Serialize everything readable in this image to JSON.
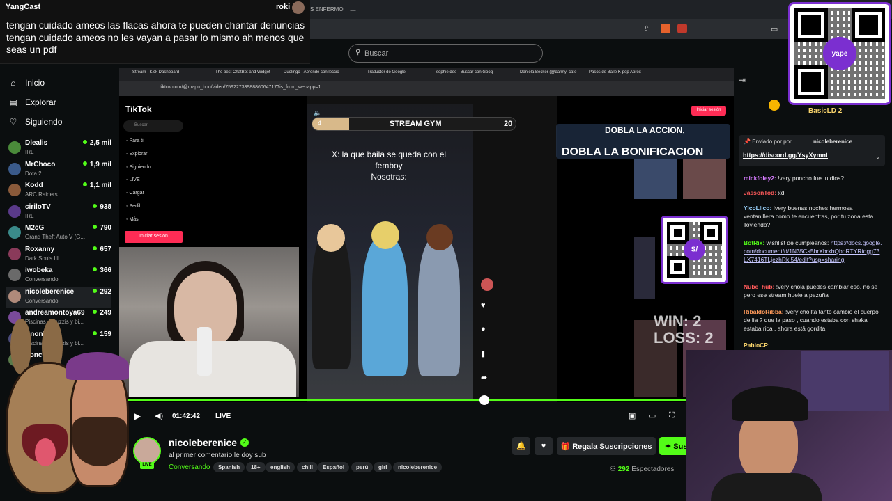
{
  "overlay": {
    "title": "YangCast",
    "user": "roki",
    "text": "tengan cuidado ameos las flacas ahora te pueden chantar denuncias tengan cuidado ameos no les vayan a pasar lo mismo ah menos que seas un pdf"
  },
  "top": {
    "tab_fragment": "S ENFERMO",
    "search_placeholder": "Buscar"
  },
  "nav": [
    {
      "label": "Inicio",
      "icon": "home-icon"
    },
    {
      "label": "Explorar",
      "icon": "compass-icon"
    },
    {
      "label": "Siguiendo",
      "icon": "heart-icon"
    }
  ],
  "channels": [
    {
      "name": "Dlealis",
      "game": "IRL",
      "viewers": "2,5 mil",
      "color": "#4a8a3a"
    },
    {
      "name": "MrChoco",
      "game": "Dota 2",
      "viewers": "1,9 mil",
      "color": "#3a5a8a"
    },
    {
      "name": "Kodd",
      "game": "ARC Raiders",
      "viewers": "1,1 mil",
      "color": "#8a5a3a"
    },
    {
      "name": "cirilоTV",
      "game": "IRL",
      "viewers": "938",
      "color": "#5a3a8a"
    },
    {
      "name": "M2cG",
      "game": "Grand Theft Auto V (G...",
      "viewers": "790",
      "color": "#3a8a8a"
    },
    {
      "name": "Roxanny",
      "game": "Dark Souls III",
      "viewers": "657",
      "color": "#8a3a5a"
    },
    {
      "name": "iwobeka",
      "game": "Conversando",
      "viewers": "366",
      "color": "#6a6a6a"
    },
    {
      "name": "nicoleberenice",
      "game": "Conversando",
      "viewers": "292",
      "color": "#b08a7a"
    },
    {
      "name": "andreamontoya69",
      "game": "Piscinas, jacuzzis y bi...",
      "viewers": "249",
      "color": "#7a4a9a"
    },
    {
      "name": "AnonEb",
      "game": "Piscinas, jacuzzis y bi...",
      "viewers": "159",
      "color": "#4a4a7a"
    },
    {
      "name": "Ponch",
      "game": "",
      "viewers": "",
      "color": "#5a7a4a"
    }
  ],
  "inner_browser": {
    "tabs": [
      "Stream - Kick Dashboard",
      "The best ChatBot and Widget",
      "Duolingo - Aprende con leccio",
      "Traductor de Google",
      "sophie dee - Buscar con Goog",
      "Daniela Becker (@danny_cate",
      "Pasos de Baile K-pop Aprox"
    ],
    "url": "tiktok.com/@mapu_boo/video/7592273398886064717?is_from_webapp=1"
  },
  "tiktok": {
    "logo": "TikTok",
    "search_placeholder": "Buscar",
    "nav": [
      "Para ti",
      "Explorar",
      "Siguiendo",
      "LIVE",
      "Cargar",
      "Perfil",
      "Más"
    ],
    "login": "Iniciar sesión",
    "login_top": "Iniciar sesión",
    "caption": "X: la que baila se queda con el femboy\nNosotras:",
    "gym_left": "4",
    "gym_title": "STREAM GYM",
    "gym_right": "20",
    "gym_progress": 0.18,
    "dobla1": "DOBLA LA ACCION,",
    "dobla2": "DOBLA LA BONIFICACION",
    "win": "WIN: 2",
    "loss": "LOSS: 2"
  },
  "player": {
    "time": "01:42:42",
    "live": "LIVE"
  },
  "channel": {
    "name": "nicoleberenice",
    "title": "al primer comentario le doy sub",
    "category": "Conversando",
    "live": "LIVE",
    "tags": [
      "Spanish",
      "18+",
      "english",
      "chill",
      "Español",
      "perú",
      "girl",
      "nicoleberenice"
    ],
    "gift": "Regala Suscripciones",
    "sub": "Suscribirse",
    "viewers_count": "292",
    "viewers_label": "Espectadores"
  },
  "chat": {
    "pinned_label": "Enviado por",
    "pinned_user": "nicoleberenice",
    "pinned_link": "https://discord.gg/YsyXymnt",
    "top_user": "BasicLD",
    "top_count": "2",
    "messages": [
      {
        "user": "mickfoley2:",
        "text": " !very poncho fue tu dios?",
        "color": "#d77bff"
      },
      {
        "user": "JassonTod:",
        "text": " xd",
        "color": "#ff5a5a"
      },
      {
        "user": "YicoLlico:",
        "text": " !very buenas noches hermosa ventanillera como te encuentras, por tu zona esta lloviendo?",
        "color": "#9ad4ff"
      },
      {
        "user": "BotRix:",
        "text": " wishlist de cumpleaños:",
        "link": "https://docs.google.com/document/d/1N35Cs5brXbrkbQboRTYRfdgg73LX7416TLjezhRkI54/edit?usp=sharing",
        "color": "#53fc18"
      },
      {
        "user": "Nube_hub:",
        "text": " !very chola puedes cambiar eso, no se pero ese stream huele a pezuña",
        "color": "#ff5a5a"
      },
      {
        "user": "RibaldoRibba:",
        "text": " !very chollta tanto cambio el cuerpo de lia ? que la paso , cuando estaba con shaka estaba rica , ahora está gordita",
        "color": "#ff9a5a"
      },
      {
        "user": "PabloCP:",
        "text": "",
        "color": "#f7d26b"
      }
    ]
  },
  "colors": {
    "kick_green": "#53fc18",
    "tiktok_red": "#fe2c55",
    "yape_purple": "#7b2fd0"
  }
}
